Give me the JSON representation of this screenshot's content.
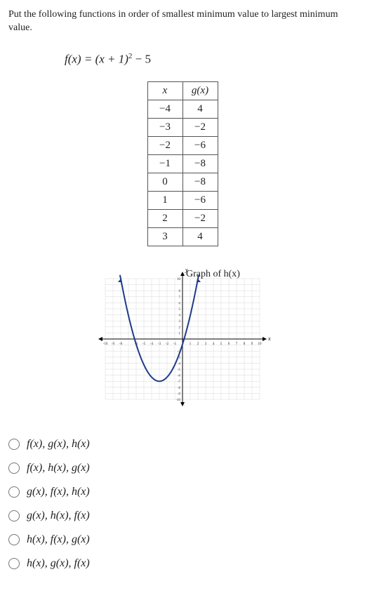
{
  "prompt": "Put the following functions in order of smallest minimum value to largest minimum value.",
  "equation": {
    "lhs": "f(x) = (x + 1)",
    "exp": "2",
    "rhs": " − 5"
  },
  "table": {
    "head_x": "x",
    "head_g": "g(x)",
    "rows": [
      [
        "−4",
        "4"
      ],
      [
        "−3",
        "−2"
      ],
      [
        "−2",
        "−6"
      ],
      [
        "−1",
        "−8"
      ],
      [
        "0",
        "−8"
      ],
      [
        "1",
        "−6"
      ],
      [
        "2",
        "−2"
      ],
      [
        "3",
        "4"
      ]
    ]
  },
  "chart_data": {
    "type": "line",
    "title": "Graph of h(x)",
    "xlabel": "x",
    "ylabel": "y",
    "xlim": [
      -10,
      10
    ],
    "ylim": [
      -10,
      10
    ],
    "x_ticks_neg": [
      "-10",
      "-9",
      "-8",
      "",
      "-6",
      "-5",
      "-4",
      "-3",
      "-2",
      "-1"
    ],
    "x_ticks_pos": [
      "1",
      "2",
      "3",
      "4",
      "5",
      "6",
      "7",
      "8",
      "9",
      "10"
    ],
    "y_ticks_pos": [
      "1",
      "2",
      "3",
      "4",
      "5",
      "6",
      "7",
      "8",
      "",
      "10"
    ],
    "y_ticks_neg": [
      "",
      "-2",
      "-3",
      "-4",
      "-5",
      "-6",
      "-7",
      "-8",
      "-9",
      "-10"
    ],
    "series": [
      {
        "name": "h(x)",
        "color": "#1f3a8a",
        "points": [
          [
            -8,
            10
          ],
          [
            -7,
            4.25
          ],
          [
            -6,
            -0.5
          ],
          [
            -5,
            -4.25
          ],
          [
            -4,
            -6.5
          ],
          [
            -3,
            -7
          ],
          [
            -2,
            -6.5
          ],
          [
            -1,
            -4.25
          ],
          [
            0,
            -0.5
          ],
          [
            1,
            4.25
          ],
          [
            2,
            10
          ]
        ]
      }
    ],
    "vertex": [
      -3,
      -7
    ]
  },
  "choices": [
    "f(x),  g(x),  h(x)",
    "f(x),  h(x),  g(x)",
    "g(x),  f(x),  h(x)",
    "g(x),  h(x),  f(x)",
    "h(x),  f(x),  g(x)",
    "h(x),  g(x),  f(x)"
  ]
}
